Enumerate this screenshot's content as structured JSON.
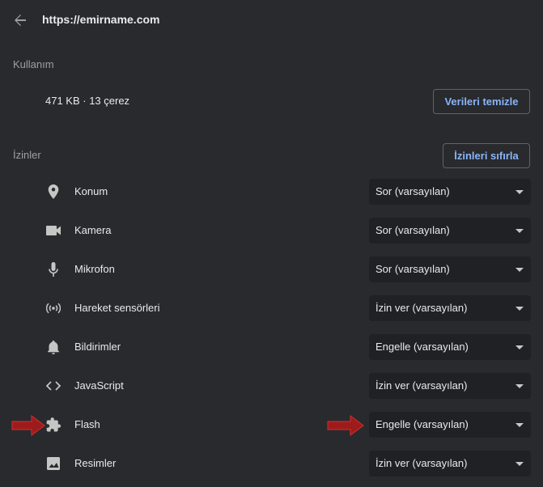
{
  "header": {
    "url": "https://emirname.com",
    "back_icon": "arrow-left-icon"
  },
  "usage": {
    "title": "Kullanım",
    "summary": "471 KB · 13 çerez",
    "clear_button": "Verileri temizle"
  },
  "permissions": {
    "title": "İzinler",
    "reset_button": "İzinleri sıfırla",
    "items": [
      {
        "label": "Konum",
        "value": "Sor (varsayılan)",
        "icon": "location-pin-icon"
      },
      {
        "label": "Kamera",
        "value": "Sor (varsayılan)",
        "icon": "camera-icon"
      },
      {
        "label": "Mikrofon",
        "value": "Sor (varsayılan)",
        "icon": "microphone-icon"
      },
      {
        "label": "Hareket sensörleri",
        "value": "İzin ver (varsayılan)",
        "icon": "motion-sensor-icon"
      },
      {
        "label": "Bildirimler",
        "value": "Engelle (varsayılan)",
        "icon": "bell-icon"
      },
      {
        "label": "JavaScript",
        "value": "İzin ver (varsayılan)",
        "icon": "code-icon"
      },
      {
        "label": "Flash",
        "value": "Engelle (varsayılan)",
        "icon": "puzzle-piece-icon"
      },
      {
        "label": "Resimler",
        "value": "İzin ver (varsayılan)",
        "icon": "image-icon"
      }
    ]
  },
  "colors": {
    "background": "#292a2d",
    "select_background": "#202124",
    "accent": "#8ab4f8",
    "annotation_arrow": "#b71c1c"
  }
}
